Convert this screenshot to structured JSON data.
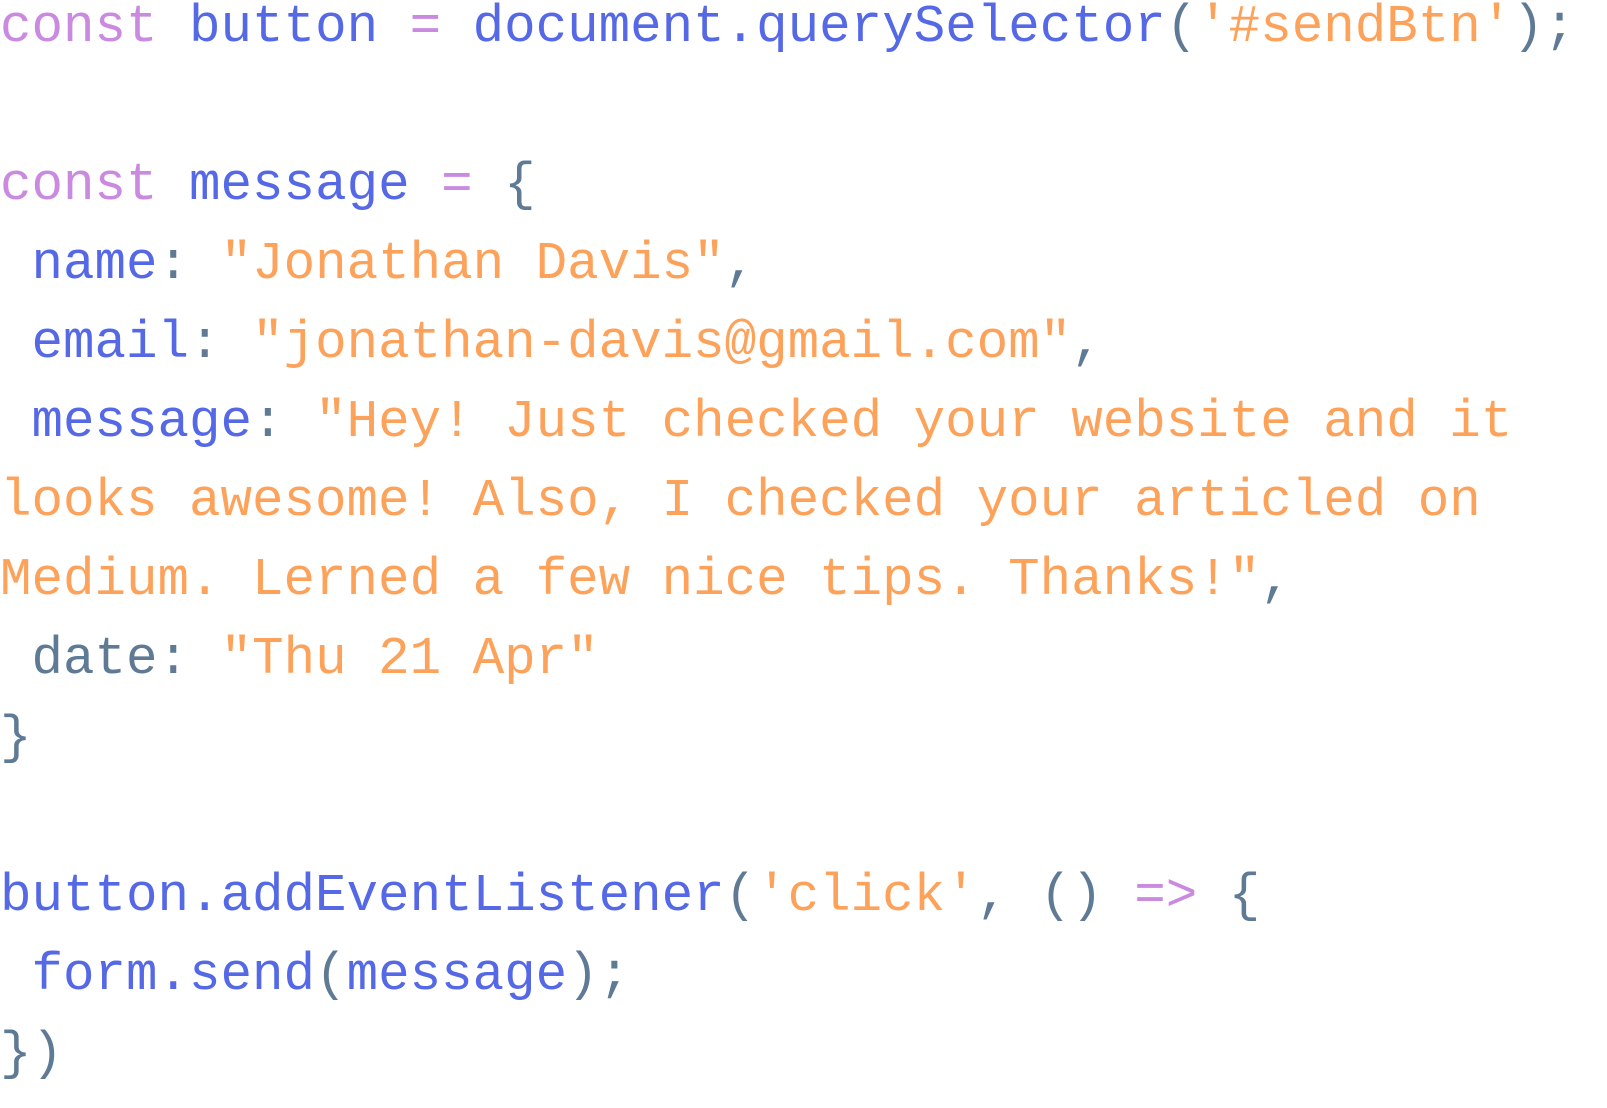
{
  "colors": {
    "kw": "#c98ae0",
    "id": "#5568e6",
    "str": "#fda25a",
    "pun": "#5f7a94"
  },
  "code_lines": [
    [
      [
        "kw",
        "const"
      ],
      [
        "pun",
        " "
      ],
      [
        "id",
        "button"
      ],
      [
        "pun",
        " "
      ],
      [
        "kw",
        "="
      ],
      [
        "pun",
        " "
      ],
      [
        "id",
        "document.querySelector"
      ],
      [
        "pun",
        "("
      ],
      [
        "str",
        "'#sendBtn'"
      ],
      [
        "pun",
        ");"
      ]
    ],
    [],
    [
      [
        "kw",
        "const"
      ],
      [
        "pun",
        " "
      ],
      [
        "id",
        "message"
      ],
      [
        "pun",
        " "
      ],
      [
        "kw",
        "="
      ],
      [
        "pun",
        " {"
      ]
    ],
    [
      [
        "pun",
        " "
      ],
      [
        "id",
        "name"
      ],
      [
        "pun",
        ": "
      ],
      [
        "str",
        "\"Jonathan Davis\""
      ],
      [
        "pun",
        ","
      ]
    ],
    [
      [
        "pun",
        " "
      ],
      [
        "id",
        "email"
      ],
      [
        "pun",
        ": "
      ],
      [
        "str",
        "\"jonathan-davis@gmail.com\""
      ],
      [
        "pun",
        ","
      ]
    ],
    [
      [
        "pun",
        " "
      ],
      [
        "id",
        "message"
      ],
      [
        "pun",
        ": "
      ],
      [
        "str",
        "\"Hey! Just checked your website and it looks awesome! Also, I checked your articled on Medium. Lerned a few nice tips. Thanks!\""
      ],
      [
        "pun",
        ","
      ]
    ],
    [
      [
        "pun",
        " date"
      ],
      [
        "pun",
        ": "
      ],
      [
        "str",
        "\"Thu 21 Apr\""
      ]
    ],
    [
      [
        "pun",
        "}"
      ]
    ],
    [],
    [
      [
        "id",
        "button.addEventListener"
      ],
      [
        "pun",
        "("
      ],
      [
        "str",
        "'click'"
      ],
      [
        "pun",
        ", () "
      ],
      [
        "kw",
        "=>"
      ],
      [
        "pun",
        " {"
      ]
    ],
    [
      [
        "pun",
        " "
      ],
      [
        "id",
        "form.send"
      ],
      [
        "pun",
        "("
      ],
      [
        "id",
        "message"
      ],
      [
        "pun",
        ");"
      ]
    ],
    [
      [
        "pun",
        "})"
      ]
    ]
  ]
}
